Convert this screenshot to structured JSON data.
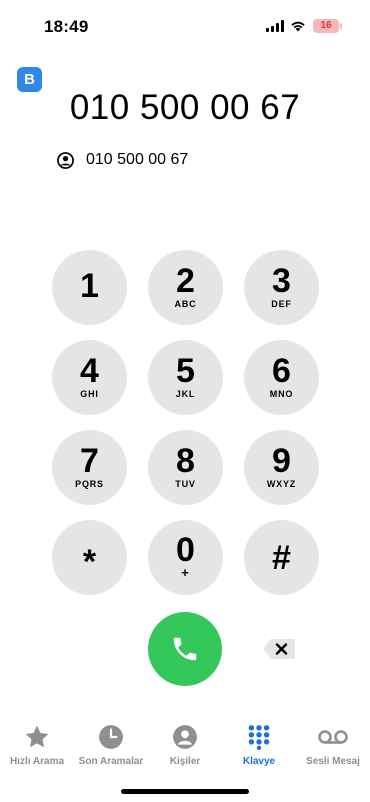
{
  "status_bar": {
    "time": "18:49",
    "battery": "16"
  },
  "app_badge": "B",
  "dialed_number": "010 500 00 67",
  "suggestion": {
    "text": "010 500 00 67"
  },
  "keypad": [
    {
      "digit": "1",
      "letters": ""
    },
    {
      "digit": "2",
      "letters": "ABC"
    },
    {
      "digit": "3",
      "letters": "DEF"
    },
    {
      "digit": "4",
      "letters": "GHI"
    },
    {
      "digit": "5",
      "letters": "JKL"
    },
    {
      "digit": "6",
      "letters": "MNO"
    },
    {
      "digit": "7",
      "letters": "PQRS"
    },
    {
      "digit": "8",
      "letters": "TUV"
    },
    {
      "digit": "9",
      "letters": "WXYZ"
    },
    {
      "digit": "*",
      "letters": ""
    },
    {
      "digit": "0",
      "letters": "+"
    },
    {
      "digit": "#",
      "letters": ""
    }
  ],
  "tabs": [
    {
      "label": "Hızlı Arama",
      "icon": "star-icon"
    },
    {
      "label": "Son Aramalar",
      "icon": "clock-icon"
    },
    {
      "label": "Kişiler",
      "icon": "person-icon"
    },
    {
      "label": "Klavye",
      "icon": "keypad-icon",
      "active": true
    },
    {
      "label": "Sesli Mesaj",
      "icon": "voicemail-icon"
    }
  ],
  "colors": {
    "accent": "#1d6fe0",
    "call": "#34c759",
    "key_bg": "#e5e5e7",
    "badge": "#2d88e6"
  }
}
